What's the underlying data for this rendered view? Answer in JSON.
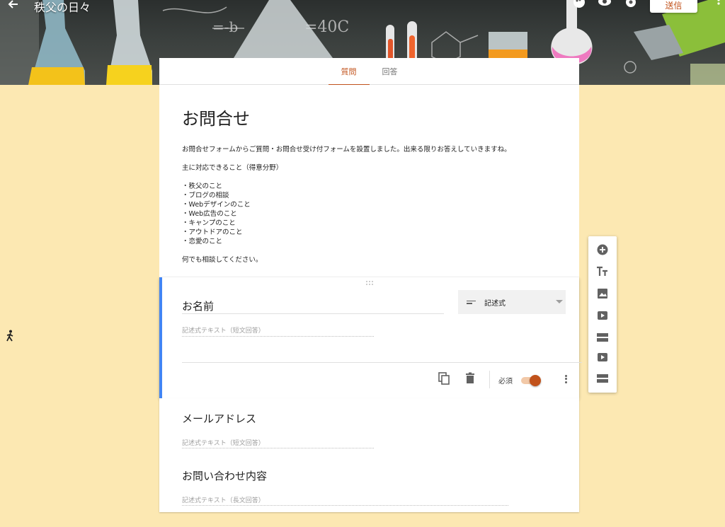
{
  "topbar": {
    "form_title": "秩父の日々",
    "send_label": "送信"
  },
  "tabs": [
    {
      "label": "質問",
      "active": true
    },
    {
      "label": "回答",
      "active": false
    }
  ],
  "form": {
    "title": "お問合せ",
    "description": [
      "お問合せフォームからご質問・お問合せ受け付フォームを設置しました。出来る限りお答えしていきますね。",
      "主に対応できること（得意分野）",
      "・秩父のこと\n・ブログの相談\n・Webデザインのこと\n・Web広告のこと\n・キャンプのこと\n・アウトドアのこと\n・恋愛のこと",
      "何でも相談してください。"
    ]
  },
  "questions": [
    {
      "title": "お名前",
      "type_label": "記述式",
      "answer_placeholder": "記述式テキスト（短文回答）",
      "required_label": "必須",
      "required": true
    },
    {
      "title": "メールアドレス",
      "answer_placeholder": "記述式テキスト（短文回答）"
    },
    {
      "title": "お問い合わせ内容",
      "answer_placeholder": "記述式テキスト（長文回答）"
    }
  ],
  "icons": {
    "back": "arrow-left-icon",
    "palette": "palette-icon",
    "preview": "eye-icon",
    "settings": "gear-icon",
    "more": "more-vert-icon",
    "copy": "copy-icon",
    "delete": "trash-icon",
    "drag": "drag-handle-icon"
  },
  "side_toolbar": [
    "add-question-icon",
    "add-title-icon",
    "add-image-icon",
    "add-video-icon",
    "add-section-icon",
    "add-video-icon",
    "add-section-icon"
  ],
  "colors": {
    "accent": "#c1521b",
    "page_bg": "#fce8b2",
    "active_card_border": "#4285f4"
  }
}
